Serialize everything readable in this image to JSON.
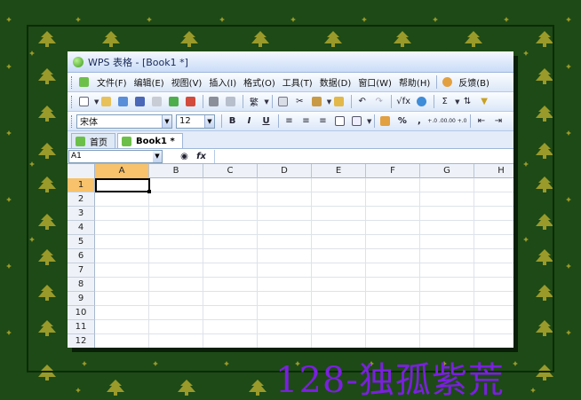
{
  "window": {
    "title": "WPS 表格 - [Book1 *]"
  },
  "menu": [
    "文件(F)",
    "编辑(E)",
    "视图(V)",
    "插入(I)",
    "格式(O)",
    "工具(T)",
    "数据(D)",
    "窗口(W)",
    "帮助(H)",
    "反馈(B)"
  ],
  "toolbar": {
    "traditional_label": "繁",
    "sum_symbol": "Σ",
    "sqrt_label": "√fx"
  },
  "format": {
    "font_name": "宋体",
    "font_size": "12",
    "bold": "B",
    "italic": "I",
    "underline": "U",
    "percent": "%",
    "comma": ",",
    "inc_decimal": "+.0 .00",
    "dec_decimal": ".00 +.0"
  },
  "tabs": [
    {
      "label": "首页"
    },
    {
      "label": "Book1 *"
    }
  ],
  "formula_bar": {
    "cell_ref": "A1",
    "fx": "fx"
  },
  "sheet": {
    "columns": [
      "A",
      "B",
      "C",
      "D",
      "E",
      "F",
      "G",
      "H"
    ],
    "rows": [
      "1",
      "2",
      "3",
      "4",
      "5",
      "6",
      "7",
      "8",
      "9",
      "10",
      "11",
      "12"
    ],
    "selected_column": "A",
    "selected_row": "1"
  },
  "watermark": "128-独孤紫荒",
  "colors": {
    "background": "#1d4a16",
    "tree": "#9a9a2a",
    "selection_header": "#f7c26b",
    "watermark": "#7b1fe0"
  }
}
